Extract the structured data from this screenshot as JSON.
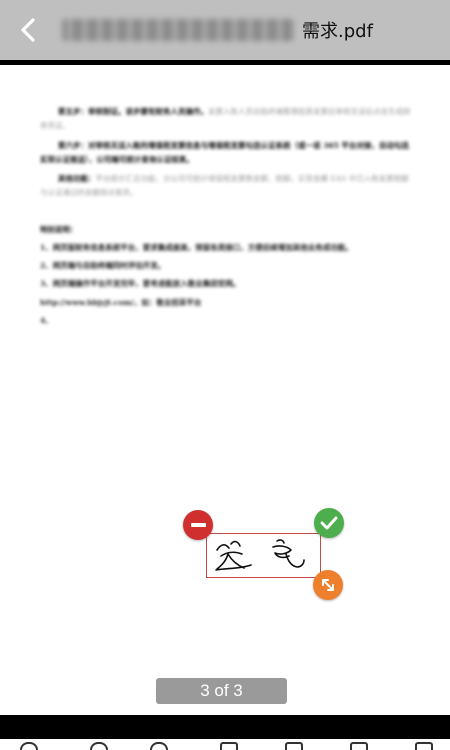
{
  "header": {
    "back_icon": "chevron-left-icon",
    "title_suffix": "需求.pdf"
  },
  "document": {
    "paragraphs": [
      {
        "lead": "第五步：审核制证。该步骤有财务人员操作。",
        "faint": "发票入账人员自助终端整理纸质发票后审核无误后点击生成财务凭证。"
      },
      {
        "lead": "第六步：对审核无误入账的增值税发票信息与增值税发票勾选认证系统（或一诺 365 平台对接，自动勾选实现认证报送），公司端可统计查询认证结果。",
        "faint": ""
      },
      {
        "lead": "其他功能：",
        "faint": "平台统计汇总功能，分公司可统计增值税发票数金额、税额，实现金蝶 EAS 中已入账发票税额与认证通过的金额核对差异。"
      }
    ],
    "section_title": "特别说明：",
    "notes": [
      "1、网页版财务信息系统平台，要求集成度高，预留各类接口，方便后续增加其他业务成功能。",
      "2、网页端与自助终端同时评估开发。",
      "3、网页端操作平台开发完毕，要考虑能放入敬业集团官网。",
      "http://www.hbjyjt.com/，如：敬业招采平台",
      "4、"
    ]
  },
  "signature": {
    "text": "签名",
    "delete_icon": "minus-circle-icon",
    "confirm_icon": "check-circle-icon",
    "resize_icon": "resize-arrows-icon"
  },
  "pager": {
    "label": "3 of 3"
  },
  "colors": {
    "header_bg": "#bfbfbf",
    "signature_border": "#c44a4a",
    "delete": "#cf2f2f",
    "confirm": "#4cae4c",
    "resize": "#ee7f2d",
    "pager_bg": "#9a9a9a"
  }
}
